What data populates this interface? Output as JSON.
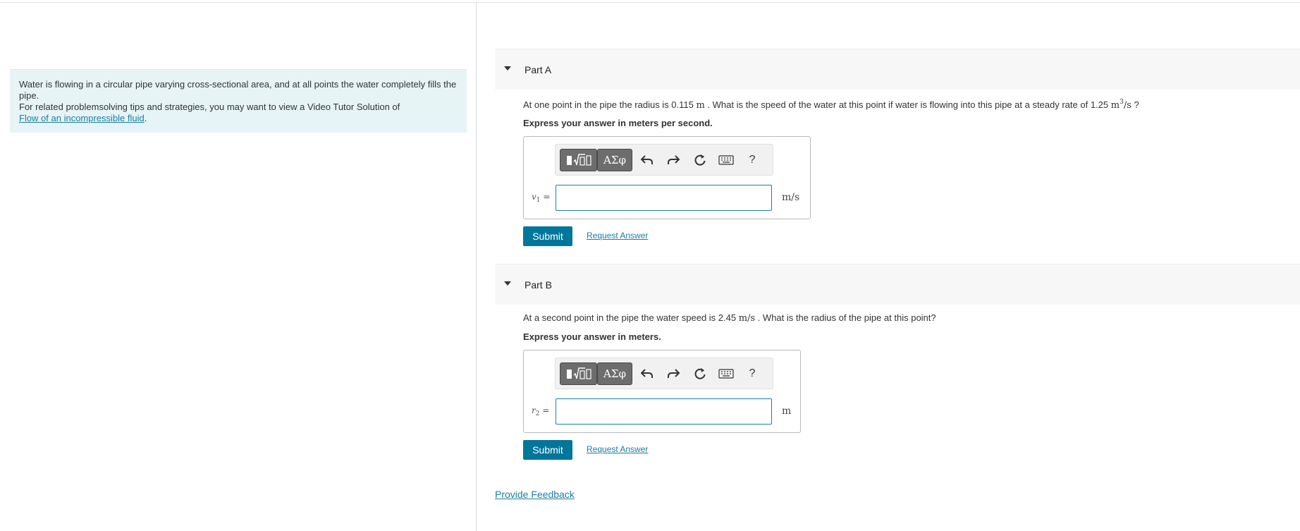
{
  "intro": {
    "line1": "Water is flowing in a circular pipe varying cross-sectional area, and at all points the water completely fills the pipe.",
    "line2": "For related problemsolving tips and strategies, you may want to view a Video Tutor Solution of",
    "link": "Flow of an incompressible fluid",
    "link_suffix": "."
  },
  "toolbar": {
    "templates_icon": "templates-icon",
    "symbols_label": "ΑΣφ",
    "undo_icon": "undo-icon",
    "redo_icon": "redo-icon",
    "reset_icon": "reset-icon",
    "keyboard_icon": "keyboard-icon",
    "help_label": "?"
  },
  "parts": [
    {
      "title": "Part A",
      "question_pre": "At one point in the pipe the radius is 0.115 ",
      "question_unit1": "m",
      "question_mid": " . What is the speed of the water at this point if water is flowing into this pipe at a steady rate of 1.25 ",
      "question_unit2_base": "m",
      "question_unit2_sup": "3",
      "question_unit2_rest": "/s",
      "question_post": " ?",
      "instruction": "Express your answer in meters per second.",
      "var_symbol": "v",
      "var_sub": "1",
      "var_eq": " =",
      "unit": "m/s",
      "submit": "Submit",
      "request": "Request Answer"
    },
    {
      "title": "Part B",
      "question_pre": "At a second point in the pipe the water speed is 2.45 ",
      "question_unit1": "m/s",
      "question_post": " . What is the radius of the pipe at this point?",
      "instruction": "Express your answer in meters.",
      "var_symbol": "r",
      "var_sub": "2",
      "var_eq": " =",
      "unit": "m",
      "submit": "Submit",
      "request": "Request Answer"
    }
  ],
  "feedback": "Provide Feedback"
}
